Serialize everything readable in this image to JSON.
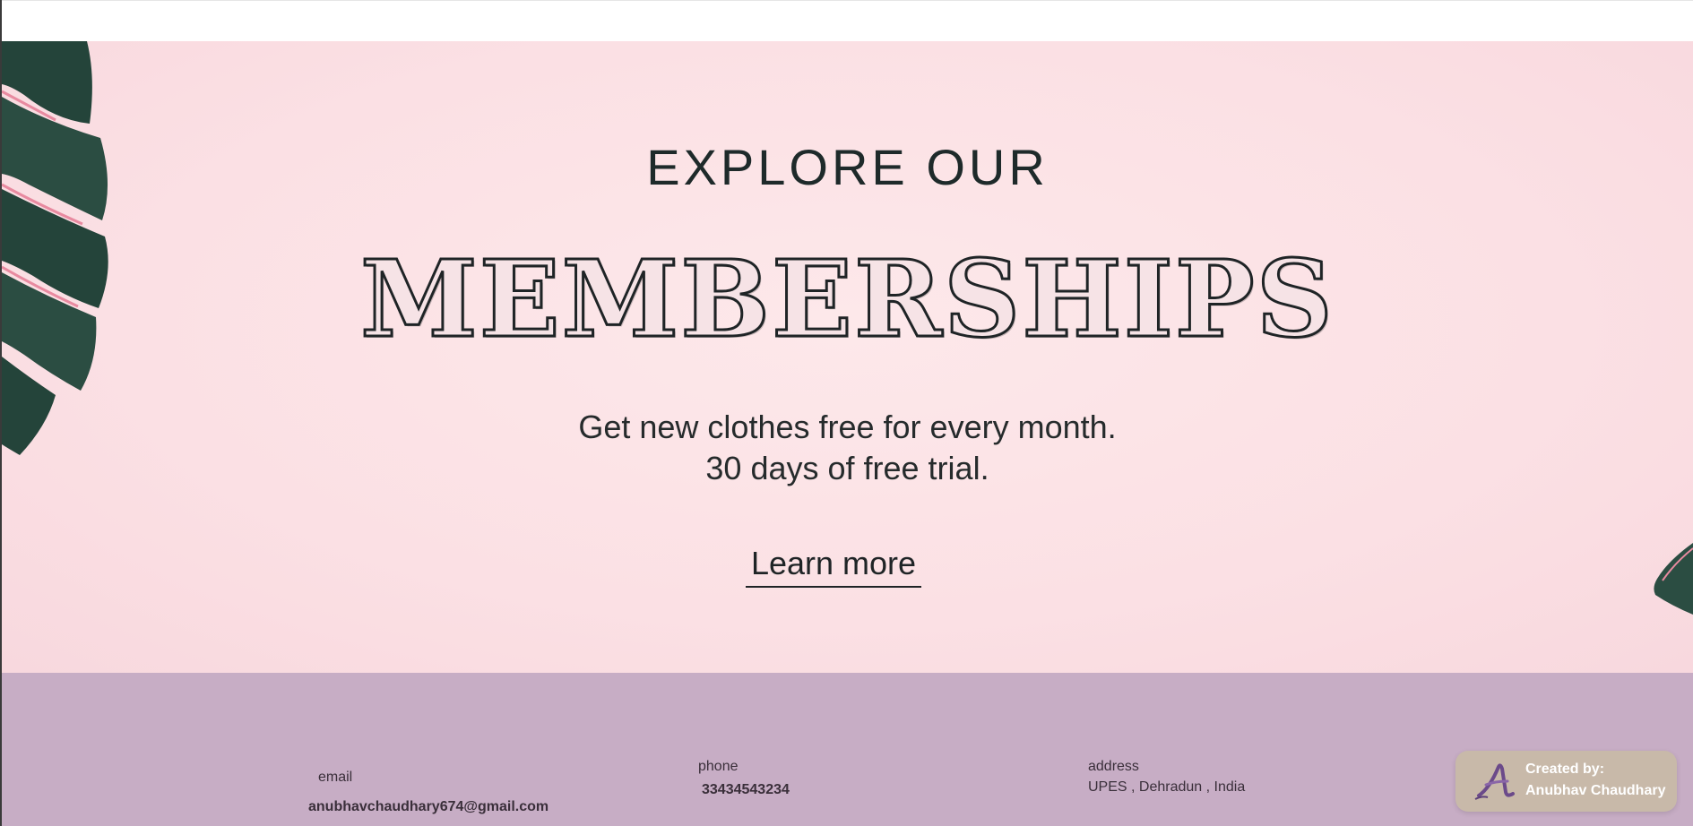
{
  "banner": {
    "heading_top": "EXPLORE OUR",
    "heading_main": "MEMBERSHIPS",
    "tagline_line1": "Get new clothes free for every month.",
    "tagline_line2": "30 days of free trial.",
    "cta_label": "Learn more",
    "background_color": "#fbe0e4",
    "decoration_icon": "monstera-leaf-icon"
  },
  "footer": {
    "background_color": "#c7adc5",
    "email": {
      "label": "email",
      "value": "anubhavchaudhary674@gmail.com"
    },
    "phone": {
      "label": "phone",
      "value": "33434543234"
    },
    "address": {
      "label": "address",
      "value": "UPES , Dehradun , India"
    }
  },
  "badge": {
    "title": "Created by:",
    "name": "Anubhav Chaudhary",
    "logo_icon": "script-a-logo-icon",
    "background_color": "#c8b9a9"
  }
}
